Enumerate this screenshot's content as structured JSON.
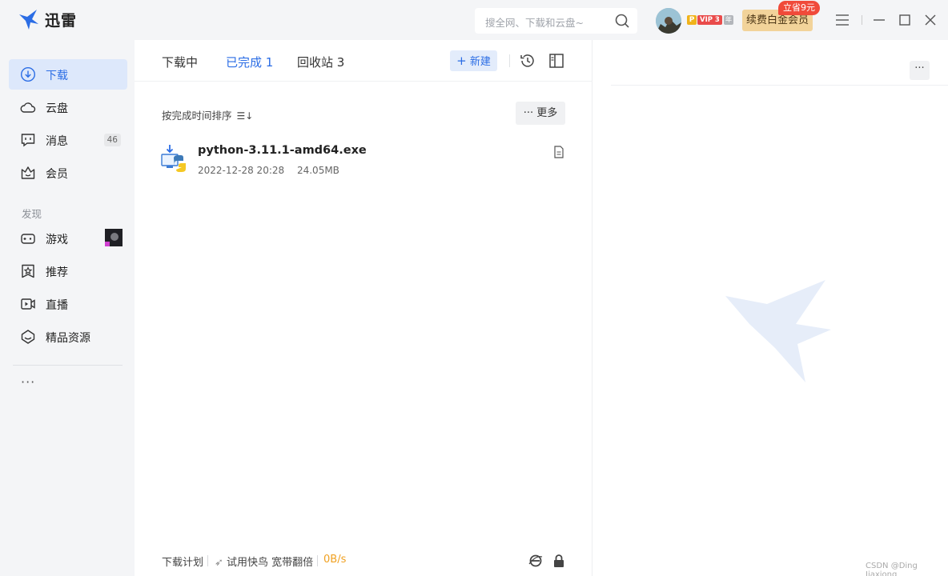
{
  "app": {
    "name": "迅雷"
  },
  "search": {
    "placeholder": "搜全网、下载和云盘~"
  },
  "user": {
    "vip_p": "P",
    "vip_label": "VIP 3",
    "vip_year": "年"
  },
  "renew": {
    "label": "续费白金会员",
    "promo": "立省9元"
  },
  "sidebar": {
    "items": [
      {
        "label": "下载",
        "icon": "download-icon"
      },
      {
        "label": "云盘",
        "icon": "cloud-icon"
      },
      {
        "label": "消息",
        "icon": "message-icon",
        "count": "46"
      },
      {
        "label": "会员",
        "icon": "crown-icon"
      }
    ],
    "section_title": "发现",
    "discover": [
      {
        "label": "游戏",
        "icon": "gamepad-icon"
      },
      {
        "label": "推荐",
        "icon": "star-icon"
      },
      {
        "label": "直播",
        "icon": "live-icon"
      },
      {
        "label": "精品资源",
        "icon": "resource-icon"
      }
    ],
    "more": "···"
  },
  "tabs": [
    {
      "label": "下载中",
      "active": false
    },
    {
      "label": "已完成 1",
      "active": true
    },
    {
      "label": "回收站 3",
      "active": false
    }
  ],
  "toolbar": {
    "new_label": "新建"
  },
  "list": {
    "sort_label": "按完成时间排序",
    "more_label": "··· 更多",
    "files": [
      {
        "name": "python-3.11.1-amd64.exe",
        "date": "2022-12-28 20:28",
        "size": "24.05MB"
      }
    ]
  },
  "footer": {
    "plan": "下载计划",
    "accelerate": "试用快鸟 宽带翻倍",
    "speed": "0B/s"
  },
  "right": {
    "more": "···"
  },
  "watermark": {
    "text": "CSDN @Ding Jiaxiong"
  },
  "colors": {
    "accent": "#2b6de5",
    "sidebar_bg": "#f4f5f7",
    "active_bg": "#dde8fb",
    "speed": "#f0a020"
  }
}
